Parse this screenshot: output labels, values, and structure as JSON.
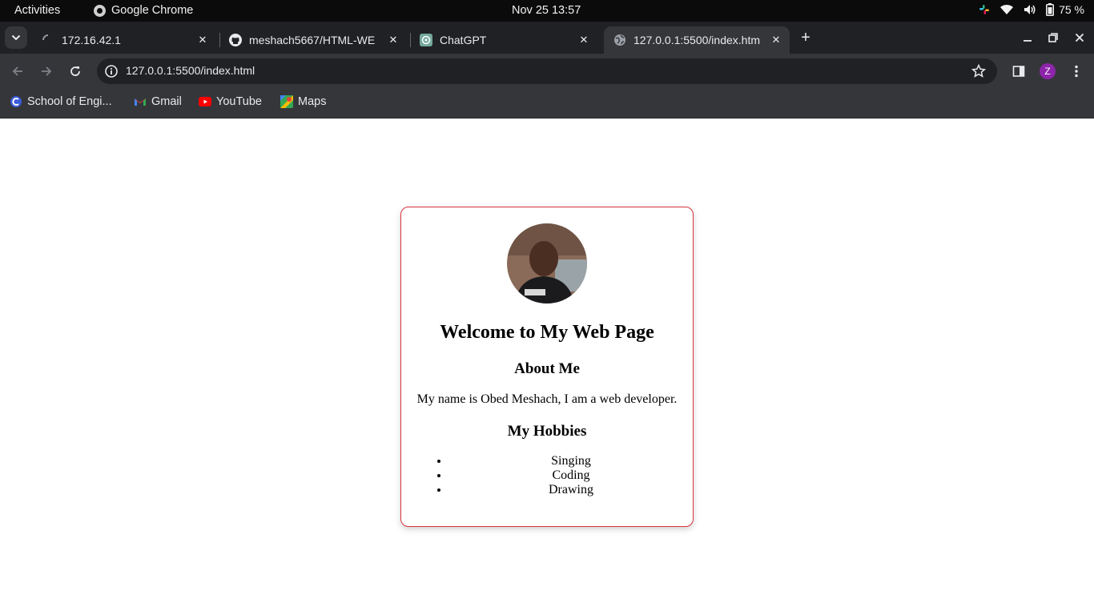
{
  "system_bar": {
    "activities": "Activities",
    "app_name": "Google Chrome",
    "clock": "Nov 25  13:57",
    "battery": "75 %"
  },
  "tabs": [
    {
      "title": "172.16.42.1",
      "favicon": "loading-spinner-icon",
      "active": false
    },
    {
      "title": "meshach5667/HTML-WE",
      "favicon": "github-icon",
      "active": false
    },
    {
      "title": "ChatGPT",
      "favicon": "chatgpt-icon",
      "active": false
    },
    {
      "title": "127.0.0.1:5500/index.htm",
      "favicon": "globe-icon",
      "active": true
    }
  ],
  "toolbar": {
    "url": "127.0.0.1:5500/index.html",
    "profile_initial": "Z",
    "profile_color": "#8e24aa"
  },
  "bookmarks": [
    {
      "label": "School of Engi...",
      "icon": "school-icon"
    },
    {
      "label": "Gmail",
      "icon": "gmail-icon"
    },
    {
      "label": "YouTube",
      "icon": "youtube-icon"
    },
    {
      "label": "Maps",
      "icon": "maps-icon"
    }
  ],
  "page": {
    "heading": "Welcome to My Web Page",
    "about_heading": "About Me",
    "about_text": "My name is Obed Meshach, I am a web developer.",
    "hobbies_heading": "My Hobbies",
    "hobbies": [
      "Singing",
      "Coding",
      "Drawing"
    ],
    "card_border_color": "#d9363e"
  }
}
